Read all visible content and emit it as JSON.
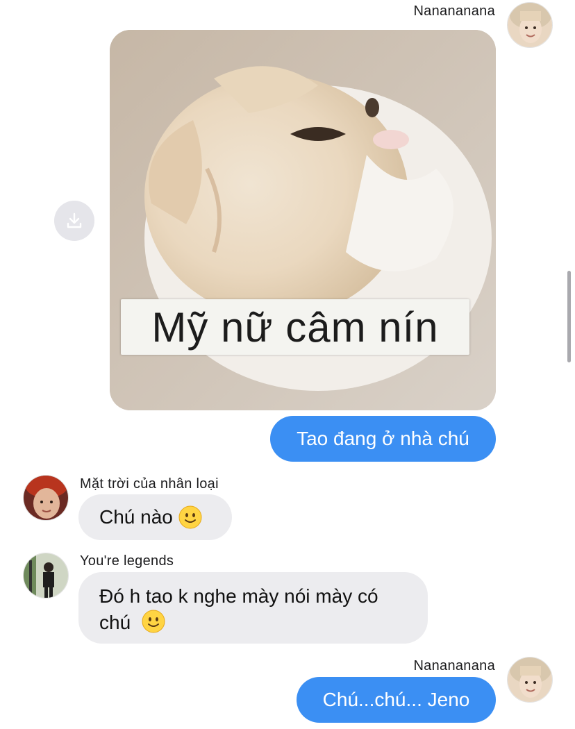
{
  "messages": [
    {
      "sender": "Nanananana",
      "type": "image",
      "caption": "Mỹ nữ câm nín",
      "image_alt": "white kitten looking up"
    },
    {
      "type": "text",
      "direction": "outgoing",
      "text": "Tao đang ở nhà chú"
    },
    {
      "sender": "Mặt trời của nhân loại",
      "type": "text",
      "direction": "incoming",
      "text": "Chú nào",
      "emoji": "slightly-smiling-face"
    },
    {
      "sender": "You're legends",
      "type": "text",
      "direction": "incoming",
      "text_line1": "Đó h tao k nghe mày nói mày có",
      "text_line2": "chú",
      "emoji": "slightly-smiling-face"
    },
    {
      "sender": "Nanananana",
      "type": "text",
      "direction": "outgoing",
      "text": "Chú...chú... Jeno"
    }
  ],
  "icons": {
    "download": "download-icon",
    "emoji": "slightly-smiling-face-icon"
  },
  "colors": {
    "outgoing_bubble": "#3b8ff3",
    "incoming_bubble": "#ececef",
    "background": "#ffffff"
  }
}
